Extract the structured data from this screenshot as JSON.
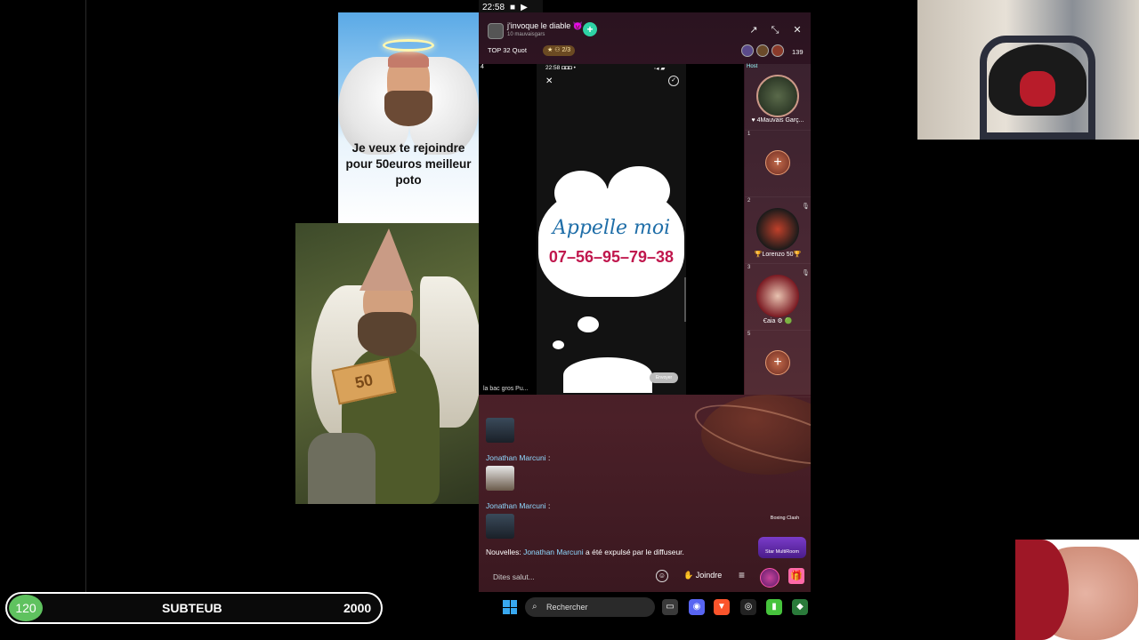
{
  "status_bar": {
    "time": "22:58",
    "icons": [
      "■",
      "▶"
    ]
  },
  "angel_meme": {
    "caption": "Je veux te rejoindre pour 50euros meilleur poto"
  },
  "elf_photo": {
    "banknote_value": "50"
  },
  "app": {
    "room_title": "j'invoque le diable 😈",
    "room_subtitle": "10 mauvaisgars",
    "follow_label": "+",
    "top_label": "TOP 32 Quot",
    "level_badge": "★ ⚇ 2/3",
    "viewer_count": "139",
    "header_icons": {
      "share": "↗",
      "minimize": "⤡",
      "close": "✕"
    },
    "video": {
      "seat_index": "4",
      "phone_status_time": "22:58 ◘◘◘ •",
      "phone_status_right": "◦◂ ▰",
      "close_glyph": "✕",
      "check_glyph": "✓",
      "cloud_title": "Appelle moi",
      "cloud_phone": "07–56–95–79–38",
      "pill_text": "Envoyer",
      "caption": "la bac gros Pu..."
    },
    "seats": [
      {
        "num": "Host",
        "label": "♥ 4Mauvais Garç...",
        "type": "avatar",
        "color": "#2b3a2a"
      },
      {
        "num": "1",
        "label": "",
        "type": "add"
      },
      {
        "num": "2",
        "label": "🏆Lorenzo 50🏆",
        "type": "avatar",
        "color": "#3a2e2a",
        "muted": "🎙"
      },
      {
        "num": "3",
        "label": "Ꞓaia ⚙ 🟢",
        "type": "avatar",
        "color": "#7a1a22",
        "muted": "🎙"
      },
      {
        "num": "5",
        "label": "",
        "type": "add"
      }
    ],
    "seat_add_glyph": "+",
    "chat": {
      "messages": [
        {
          "name": "",
          "has_image": true
        },
        {
          "name": "Jonathan Marcuni",
          "has_image": true
        },
        {
          "name": "Jonathan Marcuni",
          "has_image": true
        }
      ],
      "colon": " :",
      "notice_prefix": "Nouvelles: ",
      "notice_name": "Jonathan Marcuni",
      "notice_suffix": " a été expulsé par le diffuseur.",
      "boxing_badge": "Boxing Clash",
      "star_badge": "Star MultiRoom"
    },
    "bottom": {
      "placeholder": "Dites salut...",
      "emoji_glyph": "☺",
      "join_label": "✋ Joindre",
      "menu_glyph": "≡",
      "gift_glyph": "🎁"
    }
  },
  "subgoal": {
    "count": "120",
    "label": "SUBTEUB",
    "target": "2000"
  },
  "taskbar": {
    "search_placeholder": "Rechercher",
    "search_glyph": "⌕",
    "icons": [
      {
        "name": "file-explorer-icon",
        "glyph": "▭",
        "bg": "#3a3a3a"
      },
      {
        "name": "discord-icon",
        "glyph": "◉",
        "bg": "#5865f2"
      },
      {
        "name": "brave-icon",
        "glyph": "▼",
        "bg": "#fb542b"
      },
      {
        "name": "obs-icon",
        "glyph": "◎",
        "bg": "#222"
      },
      {
        "name": "app-green-icon",
        "glyph": "▮",
        "bg": "#46c33c"
      },
      {
        "name": "app-layers-icon",
        "glyph": "◆",
        "bg": "#2a7a3a"
      }
    ]
  },
  "colors": {
    "accent_blue": "#8fd9ff",
    "follow_green": "#2ed3a5",
    "subgoal_green": "#5fc25f",
    "phone_red": "#c0174d",
    "cloud_blue": "#1f6ea8"
  }
}
